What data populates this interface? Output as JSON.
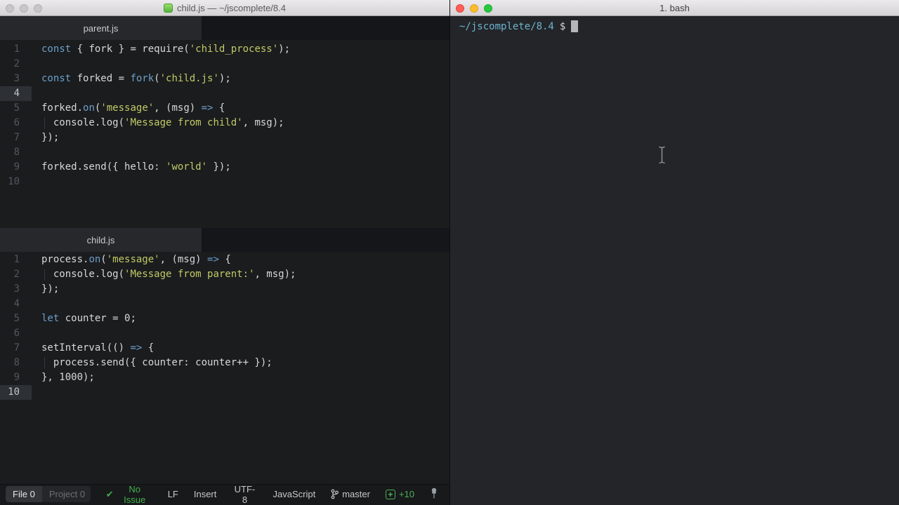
{
  "editor": {
    "titlebar": {
      "title": "child.js — ~/jscomplete/8.4"
    },
    "panes": [
      {
        "tab": "parent.js",
        "active": false,
        "current_line": 4,
        "lines": [
          [
            [
              "kw",
              "const"
            ],
            [
              "tx",
              " { fork } = require("
            ],
            [
              "st",
              "'child_process'"
            ],
            [
              "tx",
              ");"
            ]
          ],
          [],
          [
            [
              "kw",
              "const"
            ],
            [
              "tx",
              " forked = "
            ],
            [
              "fn",
              "fork"
            ],
            [
              "tx",
              "("
            ],
            [
              "st",
              "'child.js'"
            ],
            [
              "tx",
              ");"
            ]
          ],
          [],
          [
            [
              "tx",
              "forked."
            ],
            [
              "fn",
              "on"
            ],
            [
              "tx",
              "("
            ],
            [
              "st",
              "'message'"
            ],
            [
              "tx",
              ", (msg) "
            ],
            [
              "kw",
              "=>"
            ],
            [
              "tx",
              " {"
            ]
          ],
          [
            [
              "tx",
              "  console.log("
            ],
            [
              "st",
              "'Message from child'"
            ],
            [
              "tx",
              ", msg);"
            ]
          ],
          [
            [
              "tx",
              "});"
            ]
          ],
          [],
          [
            [
              "tx",
              "forked.send({ hello: "
            ],
            [
              "st",
              "'world'"
            ],
            [
              "tx",
              " });"
            ]
          ],
          []
        ]
      },
      {
        "tab": "child.js",
        "active": true,
        "current_line": 10,
        "lines": [
          [
            [
              "tx",
              "process."
            ],
            [
              "fn",
              "on"
            ],
            [
              "tx",
              "("
            ],
            [
              "st",
              "'message'"
            ],
            [
              "tx",
              ", (msg) "
            ],
            [
              "kw",
              "=>"
            ],
            [
              "tx",
              " {"
            ]
          ],
          [
            [
              "tx",
              "  console.log("
            ],
            [
              "st",
              "'Message from parent:'"
            ],
            [
              "tx",
              ", msg);"
            ]
          ],
          [
            [
              "tx",
              "});"
            ]
          ],
          [],
          [
            [
              "kw",
              "let"
            ],
            [
              "tx",
              " counter = 0;"
            ]
          ],
          [],
          [
            [
              "tx",
              "setInterval(() "
            ],
            [
              "kw",
              "=>"
            ],
            [
              "tx",
              " {"
            ]
          ],
          [
            [
              "tx",
              "  process.send({ counter: counter++ });"
            ]
          ],
          [
            [
              "tx",
              "}, 1000);"
            ]
          ],
          []
        ]
      }
    ],
    "statusbar": {
      "file_label": "File",
      "file_count": "0",
      "project_label": "Project",
      "project_count": "0",
      "issues_check": "✔",
      "issues": "No Issue",
      "line_ending": "LF",
      "mode": "Insert",
      "encoding": "UTF-8",
      "language": "JavaScript",
      "branch": "master",
      "changes": "+10",
      "plus": "+"
    }
  },
  "terminal": {
    "title": "1. bash",
    "prompt_path": "~/jscomplete/8.4",
    "prompt_symbol": "$"
  },
  "colors": {
    "keyword_blue": "#6e9fca",
    "string_yellow": "#c3ca66",
    "code_text": "#d6d8d8",
    "editor_bg": "#1a1c1e",
    "terminal_bg": "#232528",
    "status_green": "#43b14b",
    "active_pane_indicator": "#4a97e0",
    "terminal_prompt_cyan": "#6db3ce",
    "traffic_red": "#ff5f57",
    "traffic_yellow": "#febc2e",
    "traffic_green": "#28c840"
  }
}
